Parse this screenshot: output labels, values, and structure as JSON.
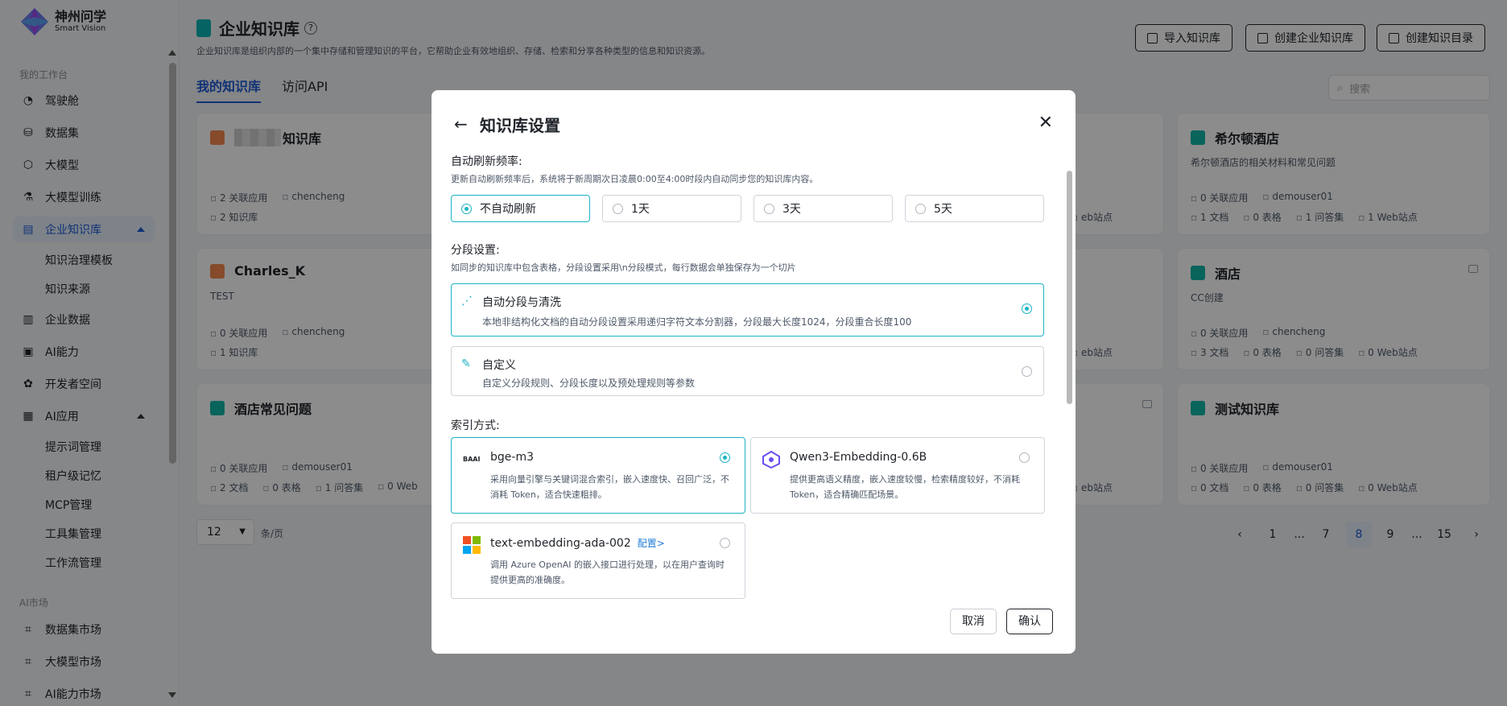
{
  "brand": {
    "cn": "神州问学",
    "en": "Smart Vision"
  },
  "sidebar": {
    "section_workbench": "我的工作台",
    "items": [
      {
        "label": "驾驶舱",
        "icon": "dashboard-icon"
      },
      {
        "label": "数据集",
        "icon": "database-icon"
      },
      {
        "label": "大模型",
        "icon": "cube-icon"
      },
      {
        "label": "大模型训练",
        "icon": "training-icon"
      },
      {
        "label": "企业知识库",
        "icon": "knowledge-icon"
      },
      {
        "label": "企业数据",
        "icon": "chart-icon"
      },
      {
        "label": "AI能力",
        "icon": "ai-icon"
      },
      {
        "label": "开发者空间",
        "icon": "developer-icon"
      },
      {
        "label": "AI应用",
        "icon": "apps-icon"
      }
    ],
    "kb_sub": [
      "知识治理模板",
      "知识来源"
    ],
    "app_sub": [
      "提示词管理",
      "租户级记忆",
      "MCP管理",
      "工具集管理",
      "工作流管理"
    ],
    "section_market": "AI市场",
    "market": [
      "数据集市场",
      "大模型市场",
      "AI能力市场"
    ]
  },
  "header": {
    "title": "企业知识库",
    "description": "企业知识库是组织内部的一个集中存储和管理知识的平台，它帮助企业有效地组织、存储、检索和分享各种类型的信息和知识资源。",
    "import_btn": "导入知识库",
    "create_btn": "创建企业知识库",
    "create_dir_btn": "创建知识目录"
  },
  "tabs": [
    "我的知识库",
    "访问API"
  ],
  "search": {
    "placeholder": "搜索"
  },
  "cards": [
    {
      "title": "知识库",
      "desc": "",
      "apps": "2 关联应用",
      "user": "chencheng",
      "row2": [
        "2 知识库"
      ]
    },
    {
      "title": "Charles_K",
      "desc": "TEST",
      "apps": "0 关联应用",
      "user": "chencheng",
      "row2": [
        "1 知识库"
      ]
    },
    {
      "title": "酒店常见问题",
      "desc": "",
      "apps": "0 关联应用",
      "user": "demouser01",
      "row2": [
        "2 文档",
        "0 表格",
        "1 问答集",
        "0 Web"
      ]
    },
    {
      "title": "希尔顿酒店",
      "desc": "希尔顿酒店的相关材料和常见问题",
      "apps": "0 关联应用",
      "user": "demouser01",
      "row2": [
        "1 文档",
        "0 表格",
        "1 问答集",
        "1 Web站点"
      ]
    },
    {
      "title": "酒店",
      "desc": "CC创建",
      "apps": "0 关联应用",
      "user": "chencheng",
      "row2": [
        "3 文档",
        "0 表格",
        "0 问答集",
        "0 Web站点"
      ]
    },
    {
      "title": "测试知识库",
      "desc": "",
      "apps": "0 关联应用",
      "user": "demouser01",
      "row2": [
        "0 文档",
        "0 表格",
        "0 问答集",
        "0 Web站点"
      ]
    }
  ],
  "partial_web": "eb站点",
  "pagination": {
    "size": "12",
    "unit": "条/页",
    "pages": [
      "1",
      "...",
      "7",
      "8",
      "9",
      "...",
      "15"
    ],
    "current": "8"
  },
  "modal": {
    "title": "知识库设置",
    "refresh_label": "自动刷新频率:",
    "refresh_hint": "更新自动刷新频率后，系统将于新周期次日凌晨0:00至4:00时段内自动同步您的知识库内容。",
    "refresh_options": [
      "不自动刷新",
      "1天",
      "3天",
      "5天"
    ],
    "refresh_selected": "不自动刷新",
    "seg_label": "分段设置:",
    "seg_hint": "如同步的知识库中包含表格，分段设置采用\\n分段模式，每行数据会单独保存为一个切片",
    "seg_options": [
      {
        "title": "自动分段与清洗",
        "desc": "本地非结构化文档的自动分段设置采用递归字符文本分割器，分段最大长度1024，分段重合长度100"
      },
      {
        "title": "自定义",
        "desc": "自定义分段规则、分段长度以及预处理规则等参数"
      }
    ],
    "index_label": "索引方式:",
    "embeddings": [
      {
        "name": "bge-m3",
        "logo": "BAAI",
        "desc": "采用向量引擎与关键词混合索引，嵌入速度快、召回广泛，不消耗 Token，适合快速粗排。"
      },
      {
        "name": "Qwen3-Embedding-0.6B",
        "desc": "提供更高语义精度，嵌入速度较慢，检索精度较好，不消耗 Token，适合精确匹配场景。"
      },
      {
        "name": "text-embedding-ada-002",
        "config": "配置>",
        "desc": "调用 Azure OpenAI 的嵌入接口进行处理，以在用户查询时提供更高的准确度。"
      }
    ],
    "cancel": "取消",
    "confirm": "确认"
  },
  "colors": {
    "accent": "#1ab4c4",
    "primary": "#1e5bd6",
    "overlay": "rgba(0,0,0,0.45)"
  }
}
